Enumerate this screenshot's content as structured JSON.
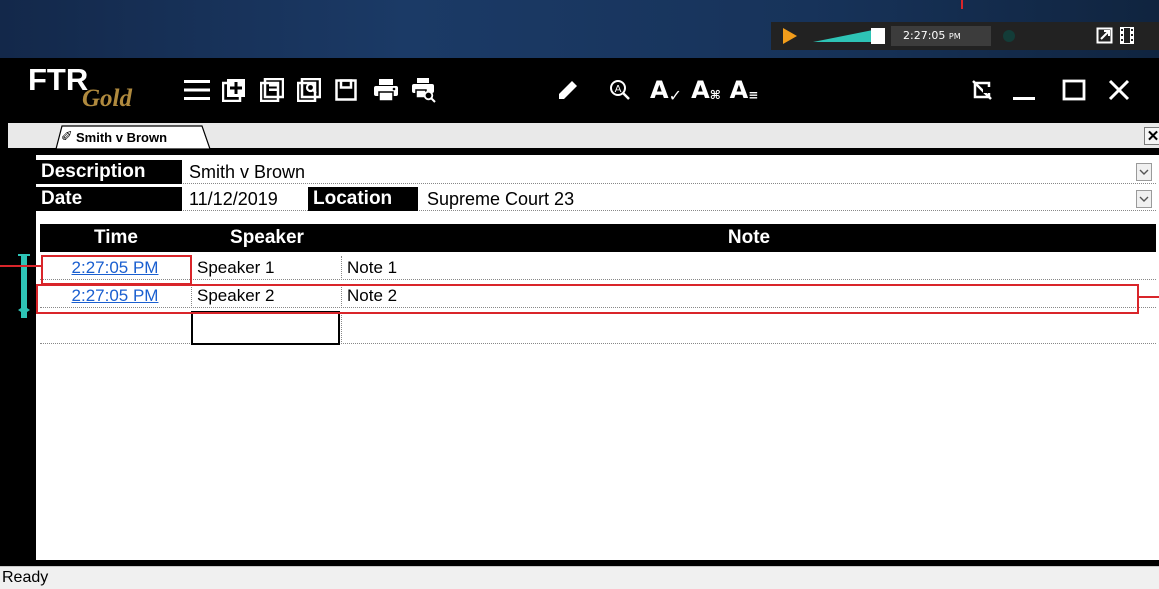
{
  "mini_player": {
    "time_main": "2:27:05",
    "time_ampm": "PM",
    "icons": [
      "play-icon",
      "volume-icon",
      "record-indicator-icon",
      "popout-icon",
      "film-icon"
    ]
  },
  "app": {
    "logo_main": "FTR",
    "logo_sub": "Gold",
    "toolbar_icons": [
      "menu-icon",
      "new-document-icon",
      "open-document-icon",
      "open-search-icon",
      "save-icon",
      "print-icon",
      "print-preview-icon",
      "edit-pencil-icon",
      "find-icon",
      "spell-check-icon",
      "special-characters-icon",
      "text-list-icon"
    ],
    "toolbar_text": {
      "spell": "A",
      "spell_check": "✓",
      "special": "A",
      "special_sub": "⌘",
      "list": "A",
      "list_sub": "≡"
    },
    "window_controls": [
      "unpin-icon",
      "minimize-icon",
      "maximize-icon",
      "close-icon"
    ]
  },
  "tab": {
    "icon": "✐",
    "label": "Smith v Brown",
    "close_label": "✕"
  },
  "header": {
    "description_label": "Description",
    "description_value": "Smith v Brown",
    "date_label": "Date",
    "date_value": "11/12/2019",
    "location_label": "Location",
    "location_value": "Supreme Court 23"
  },
  "grid": {
    "columns": [
      "Time",
      "Speaker",
      "Note"
    ],
    "rows": [
      {
        "time": "2:27:05 PM",
        "speaker": "Speaker 1",
        "note": "Note 1"
      },
      {
        "time": "2:27:05 PM",
        "speaker": "Speaker 2",
        "note": "Note 2"
      }
    ]
  },
  "status": {
    "text": "Ready"
  },
  "colors": {
    "accent_play": "#f29d1b",
    "accent_teal": "#2ec4b6",
    "annotation_red": "#d9252a",
    "link_blue": "#1a5fd0",
    "logo_gold": "#b08a3e"
  }
}
